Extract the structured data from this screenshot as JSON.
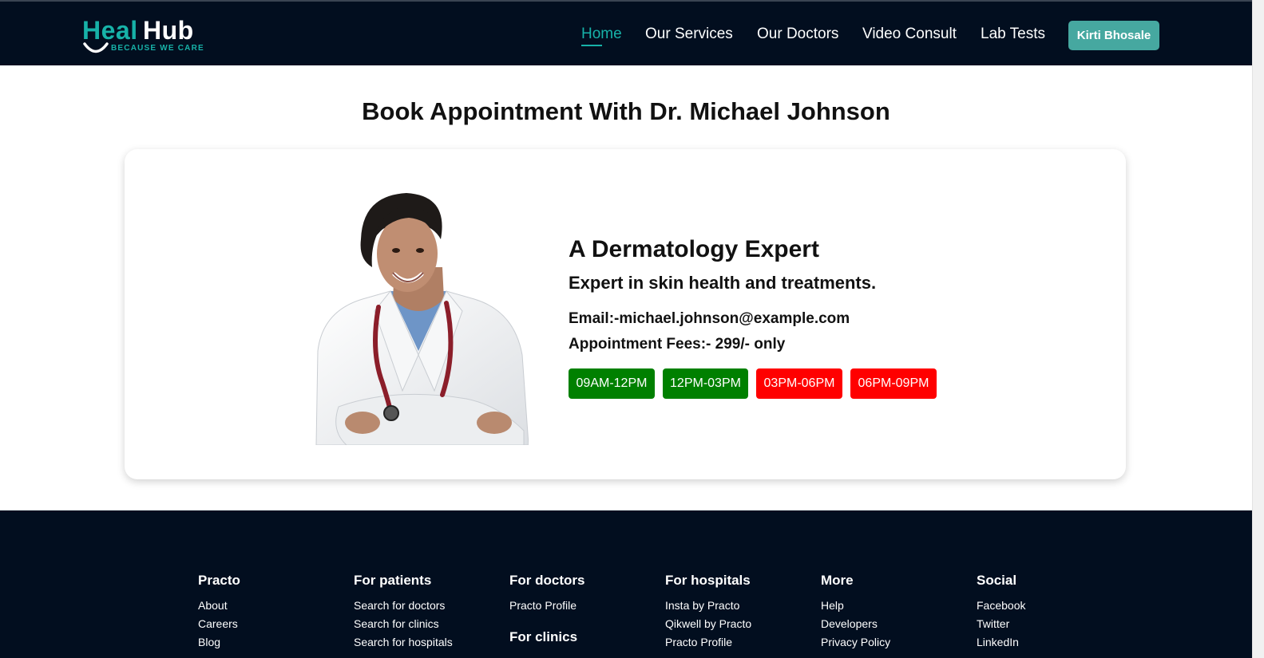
{
  "brand": {
    "name_part1": "Heal",
    "name_part2": "Hub",
    "tagline": "BECAUSE WE CARE",
    "accent": "#17b2a8"
  },
  "nav": {
    "items": [
      "Home",
      "Our Services",
      "Our Doctors",
      "Video Consult",
      "Lab Tests"
    ],
    "active": "Home",
    "user_button": "Kirti Bhosale"
  },
  "page": {
    "title": "Book Appointment With Dr. Michael Johnson"
  },
  "doctor": {
    "specialty": "A Dermatology Expert",
    "description": "Expert in skin health and treatments.",
    "email_line": "Email:-michael.johnson@example.com",
    "fees_line": "Appointment Fees:- 299/- only",
    "photo": "doctor-photo"
  },
  "slots": [
    {
      "label": "09AM-12PM",
      "status": "available",
      "color": "#008000"
    },
    {
      "label": "12PM-03PM",
      "status": "available",
      "color": "#008000"
    },
    {
      "label": "03PM-06PM",
      "status": "booked",
      "color": "#ff0000"
    },
    {
      "label": "06PM-09PM",
      "status": "booked",
      "color": "#ff0000"
    }
  ],
  "footer": {
    "practo": {
      "title": "Practo",
      "links": [
        "About",
        "Careers",
        "Blog"
      ]
    },
    "patients": {
      "title": "For patients",
      "links": [
        "Search for doctors",
        "Search for clinics",
        "Search for hospitals"
      ]
    },
    "doctors": {
      "title": "For doctors",
      "links": [
        "Practo Profile"
      ]
    },
    "clinics": {
      "title": "For clinics"
    },
    "hospitals": {
      "title": "For hospitals",
      "links": [
        "Insta by Practo",
        "Qikwell by Practo",
        "Practo Profile"
      ]
    },
    "more": {
      "title": "More",
      "links": [
        "Help",
        "Developers",
        "Privacy Policy"
      ]
    },
    "social": {
      "title": "Social",
      "links": [
        "Facebook",
        "Twitter",
        "LinkedIn"
      ]
    }
  }
}
